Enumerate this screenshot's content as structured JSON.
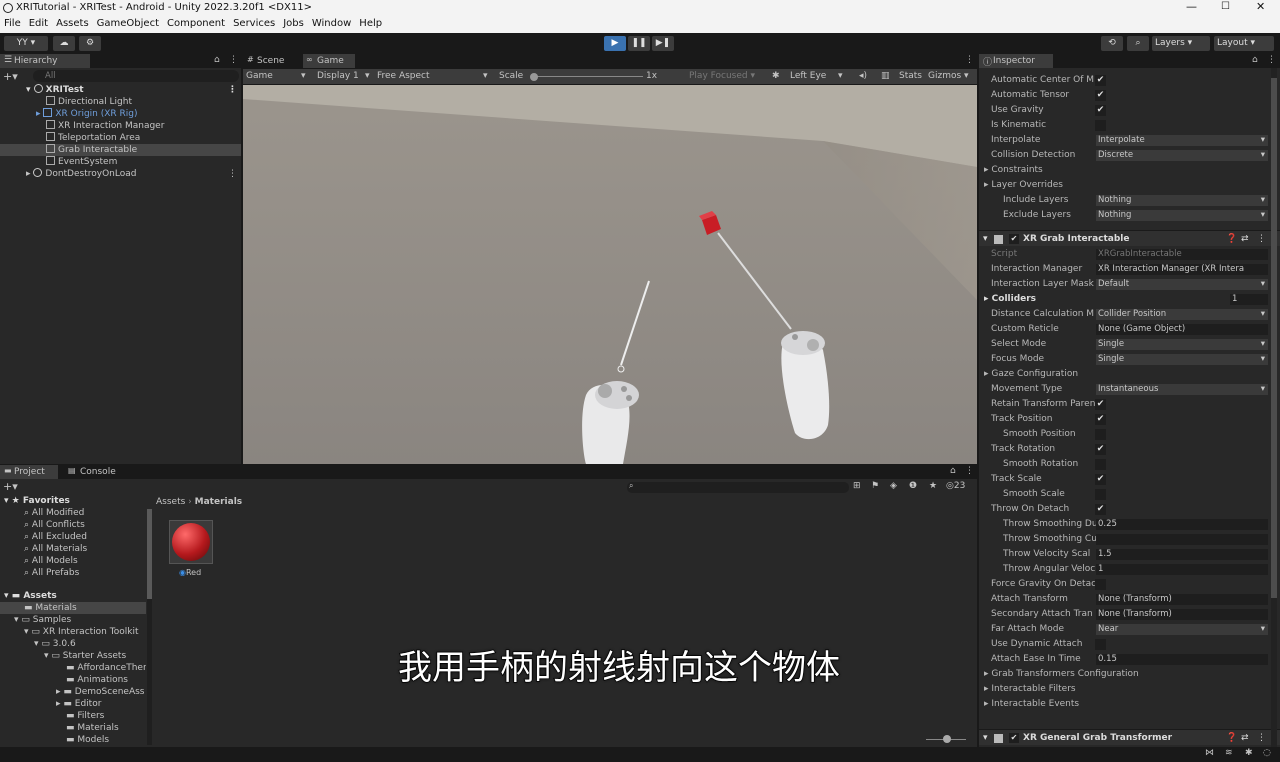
{
  "window": {
    "title": "XRITutorial - XRITest - Android - Unity 2022.3.20f1 <DX11>"
  },
  "menu": [
    "File",
    "Edit",
    "Assets",
    "GameObject",
    "Component",
    "Services",
    "Jobs",
    "Window",
    "Help"
  ],
  "toolbar": {
    "account": "YY",
    "layers": "Layers",
    "layout": "Layout"
  },
  "hierarchy": {
    "tab": "Hierarchy",
    "search_placeholder": "All",
    "scene": "XRITest",
    "items": [
      "Directional Light",
      "XR Origin (XR Rig)",
      "XR Interaction Manager",
      "Teleportation Area",
      "Grab Interactable",
      "EventSystem"
    ],
    "dont_destroy": "DontDestroyOnLoad"
  },
  "scene_tabs": {
    "scene": "Scene",
    "game": "Game"
  },
  "game_bar": {
    "mode": "Game",
    "display": "Display 1",
    "aspect": "Free Aspect",
    "scale_label": "Scale",
    "scale_value": "1x",
    "play_focused": "Play Focused",
    "eye": "Left Eye",
    "stats": "Stats",
    "gizmos": "Gizmos"
  },
  "project": {
    "tab_project": "Project",
    "tab_console": "Console",
    "hidden_count": "23",
    "favorites_label": "Favorites",
    "favorites": [
      "All Modified",
      "All Conflicts",
      "All Excluded",
      "All Materials",
      "All Models",
      "All Prefabs"
    ],
    "assets_label": "Assets",
    "tree": [
      "Materials",
      "Samples",
      "XR Interaction Toolkit",
      "3.0.6",
      "Starter Assets",
      "AffordanceTher",
      "Animations",
      "DemoSceneAss",
      "Editor",
      "Filters",
      "Materials",
      "Models"
    ],
    "breadcrumb": [
      "Assets",
      "Materials"
    ],
    "asset_name": "Red"
  },
  "inspector": {
    "tab": "Inspector",
    "rigidbody_rows": [
      {
        "label": "Automatic Center Of M",
        "type": "check",
        "value": "✔"
      },
      {
        "label": "Automatic Tensor",
        "type": "check",
        "value": "✔"
      },
      {
        "label": "Use Gravity",
        "type": "check",
        "value": "✔"
      },
      {
        "label": "Is Kinematic",
        "type": "check",
        "value": ""
      },
      {
        "label": "Interpolate",
        "type": "drop",
        "value": "Interpolate"
      },
      {
        "label": "Collision Detection",
        "type": "drop",
        "value": "Discrete"
      },
      {
        "label": "Constraints",
        "type": "fold",
        "value": ""
      },
      {
        "label": "Layer Overrides",
        "type": "fold",
        "value": ""
      },
      {
        "label": "Include Layers",
        "type": "drop",
        "value": "Nothing",
        "indent": true
      },
      {
        "label": "Exclude Layers",
        "type": "drop",
        "value": "Nothing",
        "indent": true
      }
    ],
    "component_title": "XR Grab Interactable",
    "grab_rows": [
      {
        "label": "Script",
        "type": "field",
        "value": "XRGrabInteractable",
        "dim": true
      },
      {
        "label": "Interaction Manager",
        "type": "field",
        "value": "XR Interaction Manager (XR Intera"
      },
      {
        "label": "Interaction Layer Mask",
        "type": "drop",
        "value": "Default"
      },
      {
        "label": "Colliders",
        "type": "foldnum",
        "value": "1"
      },
      {
        "label": "Distance Calculation M",
        "type": "drop",
        "value": "Collider Position"
      },
      {
        "label": "Custom Reticle",
        "type": "field",
        "value": "None (Game Object)"
      },
      {
        "label": "Select Mode",
        "type": "drop",
        "value": "Single"
      },
      {
        "label": "Focus Mode",
        "type": "drop",
        "value": "Single"
      },
      {
        "label": "Gaze Configuration",
        "type": "fold",
        "value": ""
      },
      {
        "label": "Movement Type",
        "type": "drop",
        "value": "Instantaneous"
      },
      {
        "label": "Retain Transform Paren",
        "type": "check",
        "value": "✔"
      },
      {
        "label": "Track Position",
        "type": "check",
        "value": "✔"
      },
      {
        "label": "Smooth Position",
        "type": "check",
        "value": "",
        "indent": true
      },
      {
        "label": "Track Rotation",
        "type": "check",
        "value": "✔"
      },
      {
        "label": "Smooth Rotation",
        "type": "check",
        "value": "",
        "indent": true
      },
      {
        "label": "Track Scale",
        "type": "check",
        "value": "✔"
      },
      {
        "label": "Smooth Scale",
        "type": "check",
        "value": "",
        "indent": true
      },
      {
        "label": "Throw On Detach",
        "type": "check",
        "value": "✔"
      },
      {
        "label": "Throw Smoothing Du",
        "type": "field",
        "value": "0.25",
        "indent": true
      },
      {
        "label": "Throw Smoothing Cu",
        "type": "field",
        "value": "",
        "indent": true
      },
      {
        "label": "Throw Velocity Scal",
        "type": "field",
        "value": "1.5",
        "indent": true
      },
      {
        "label": "Throw Angular Veloc",
        "type": "field",
        "value": "1",
        "indent": true
      },
      {
        "label": "Force Gravity On Detac",
        "type": "check",
        "value": ""
      },
      {
        "label": "Attach Transform",
        "type": "field",
        "value": "None (Transform)"
      },
      {
        "label": "Secondary Attach Tran",
        "type": "field",
        "value": "None (Transform)"
      },
      {
        "label": "Far Attach Mode",
        "type": "drop",
        "value": "Near"
      },
      {
        "label": "Use Dynamic Attach",
        "type": "check",
        "value": ""
      },
      {
        "label": "Attach Ease In Time",
        "type": "field",
        "value": "0.15"
      },
      {
        "label": "Grab Transformers Configuration",
        "type": "fold",
        "value": ""
      },
      {
        "label": "Interactable Filters",
        "type": "fold",
        "value": ""
      },
      {
        "label": "Interactable Events",
        "type": "fold",
        "value": ""
      }
    ],
    "next_component": "XR General Grab Transformer"
  },
  "subtitle": "我用手柄的射线射向这个物体",
  "colors": {
    "accent": "#3a72b0",
    "cube": "#c81d25",
    "sphere": "#b5191d"
  }
}
